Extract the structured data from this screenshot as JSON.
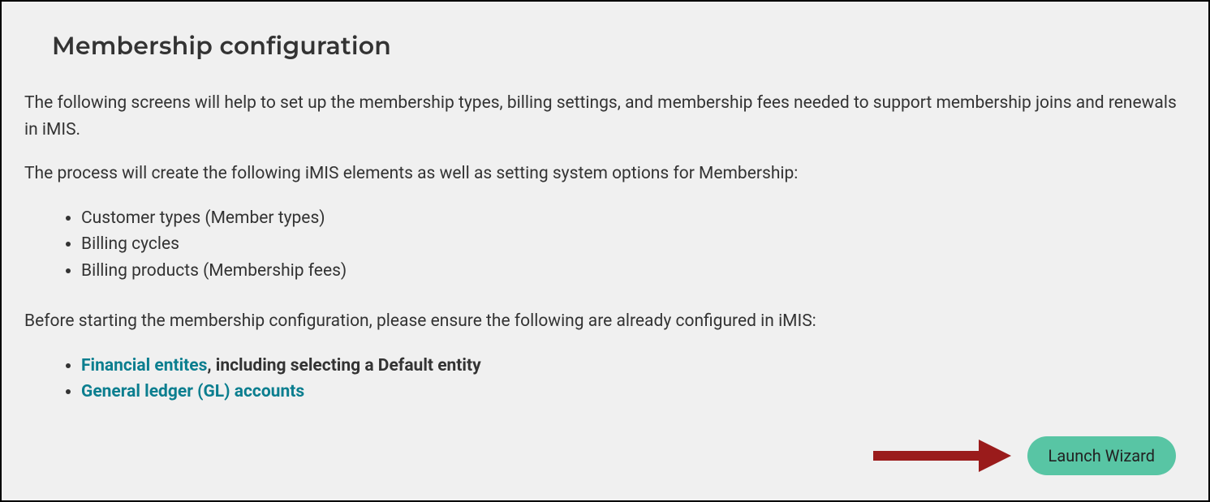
{
  "header": {
    "title": "Membership configuration"
  },
  "intro": {
    "paragraph1": "The following screens will help to set up the membership types, billing settings, and membership fees needed to support membership joins and renewals in iMIS.",
    "paragraph2": "The process will create the following iMIS elements as well as setting system options for Membership:"
  },
  "elements_list": [
    "Customer types (Member types)",
    "Billing cycles",
    "Billing products (Membership fees)"
  ],
  "prereq": {
    "lead": "Before starting the membership configuration, please ensure the following are already configured in iMIS:",
    "items": [
      {
        "link_text": "Financial entites",
        "suffix": ", including selecting a Default entity"
      },
      {
        "link_text": "General ledger (GL) accounts",
        "suffix": ""
      }
    ]
  },
  "actions": {
    "launch_label": "Launch Wizard"
  },
  "annotation": {
    "arrow_color": "#9a1b1b"
  }
}
